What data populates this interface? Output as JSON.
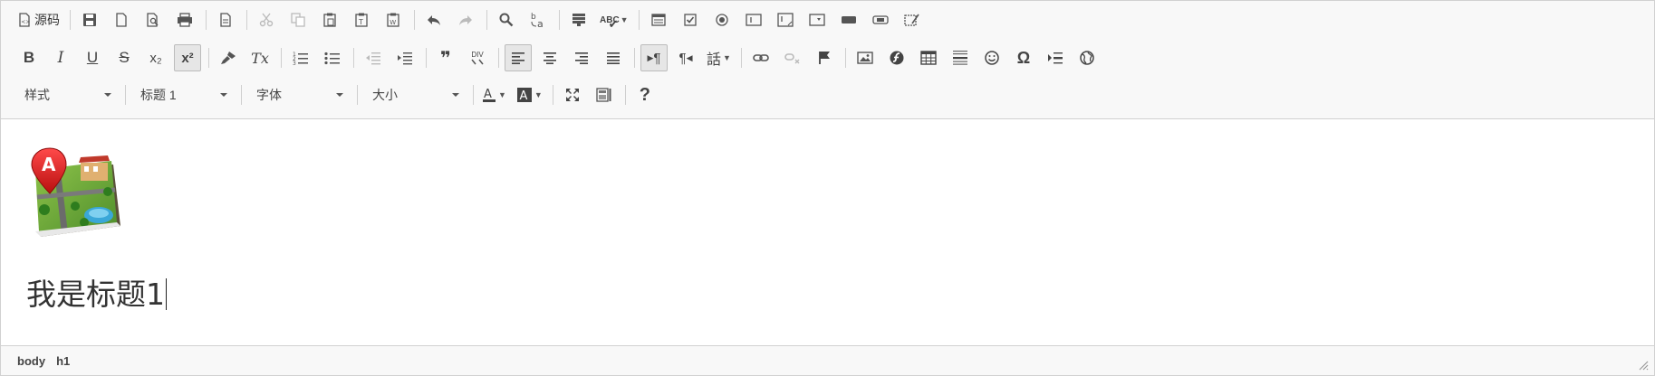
{
  "toolbar": {
    "source_label": "源码",
    "combos": {
      "styles": "样式",
      "format": "标题 1",
      "font": "字体",
      "size": "大小"
    },
    "glyphs": {
      "bold": "B",
      "italic": "I",
      "underline": "U",
      "strike": "S",
      "subscript": "x₂",
      "superscript": "x²",
      "remove_format": "Tx",
      "blockquote": "❞",
      "div": "DIV",
      "special_char": "Ω",
      "help": "?",
      "ltr": "¶",
      "rtl": "¶",
      "language": "話",
      "spellcheck": "ABC"
    }
  },
  "content": {
    "heading": "我是标题1",
    "image_icon": "map-app-icon"
  },
  "statusbar": {
    "path": [
      "body",
      "h1"
    ]
  },
  "colors": {
    "toolbar_bg": "#f8f8f8",
    "border": "#d1d1d1",
    "icon": "#444444",
    "disabled_icon": "#bbbbbb"
  }
}
